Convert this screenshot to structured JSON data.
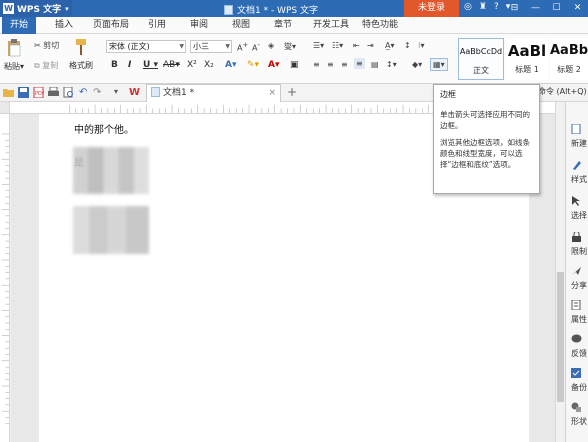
{
  "titlebar": {
    "app_name": "WPS 文字",
    "doc_title": "文档1 * - WPS 文字",
    "login": "未登录",
    "window_buttons": [
      "minimize",
      "maximize",
      "close"
    ]
  },
  "tabs": [
    "开始",
    "插入",
    "页面布局",
    "引用",
    "审阅",
    "视图",
    "章节",
    "开发工具",
    "特色功能"
  ],
  "ribbon": {
    "paste": "粘贴",
    "cut": "剪切",
    "copy": "复制",
    "format_painter": "格式刷",
    "font_name": "宋体 (正文)",
    "font_size": "小三",
    "styles": [
      {
        "preview": "AaBbCcDd",
        "label": "正文"
      },
      {
        "preview": "AaBl",
        "label": "标题 1"
      },
      {
        "preview": "AaBb",
        "label": "标题 2"
      }
    ]
  },
  "doc_tab": {
    "label": "文档1 *"
  },
  "command_hint": "命令 (Alt+Q)",
  "document": {
    "line1": "中的那个他。",
    "line2": "是"
  },
  "tooltip": {
    "title": "边框",
    "p1": "单击箭头可选择应用不同的边框。",
    "p2": "浏览其他边框选项，如线条颜色和线型宽度，可以选择“边框和底纹”选项。"
  },
  "side_panel": [
    "新建",
    "样式",
    "选择",
    "限制",
    "分享",
    "属性",
    "反馈",
    "备份",
    "形状"
  ],
  "colors": {
    "accent": "#2d6bb5",
    "login": "#e2572c"
  }
}
